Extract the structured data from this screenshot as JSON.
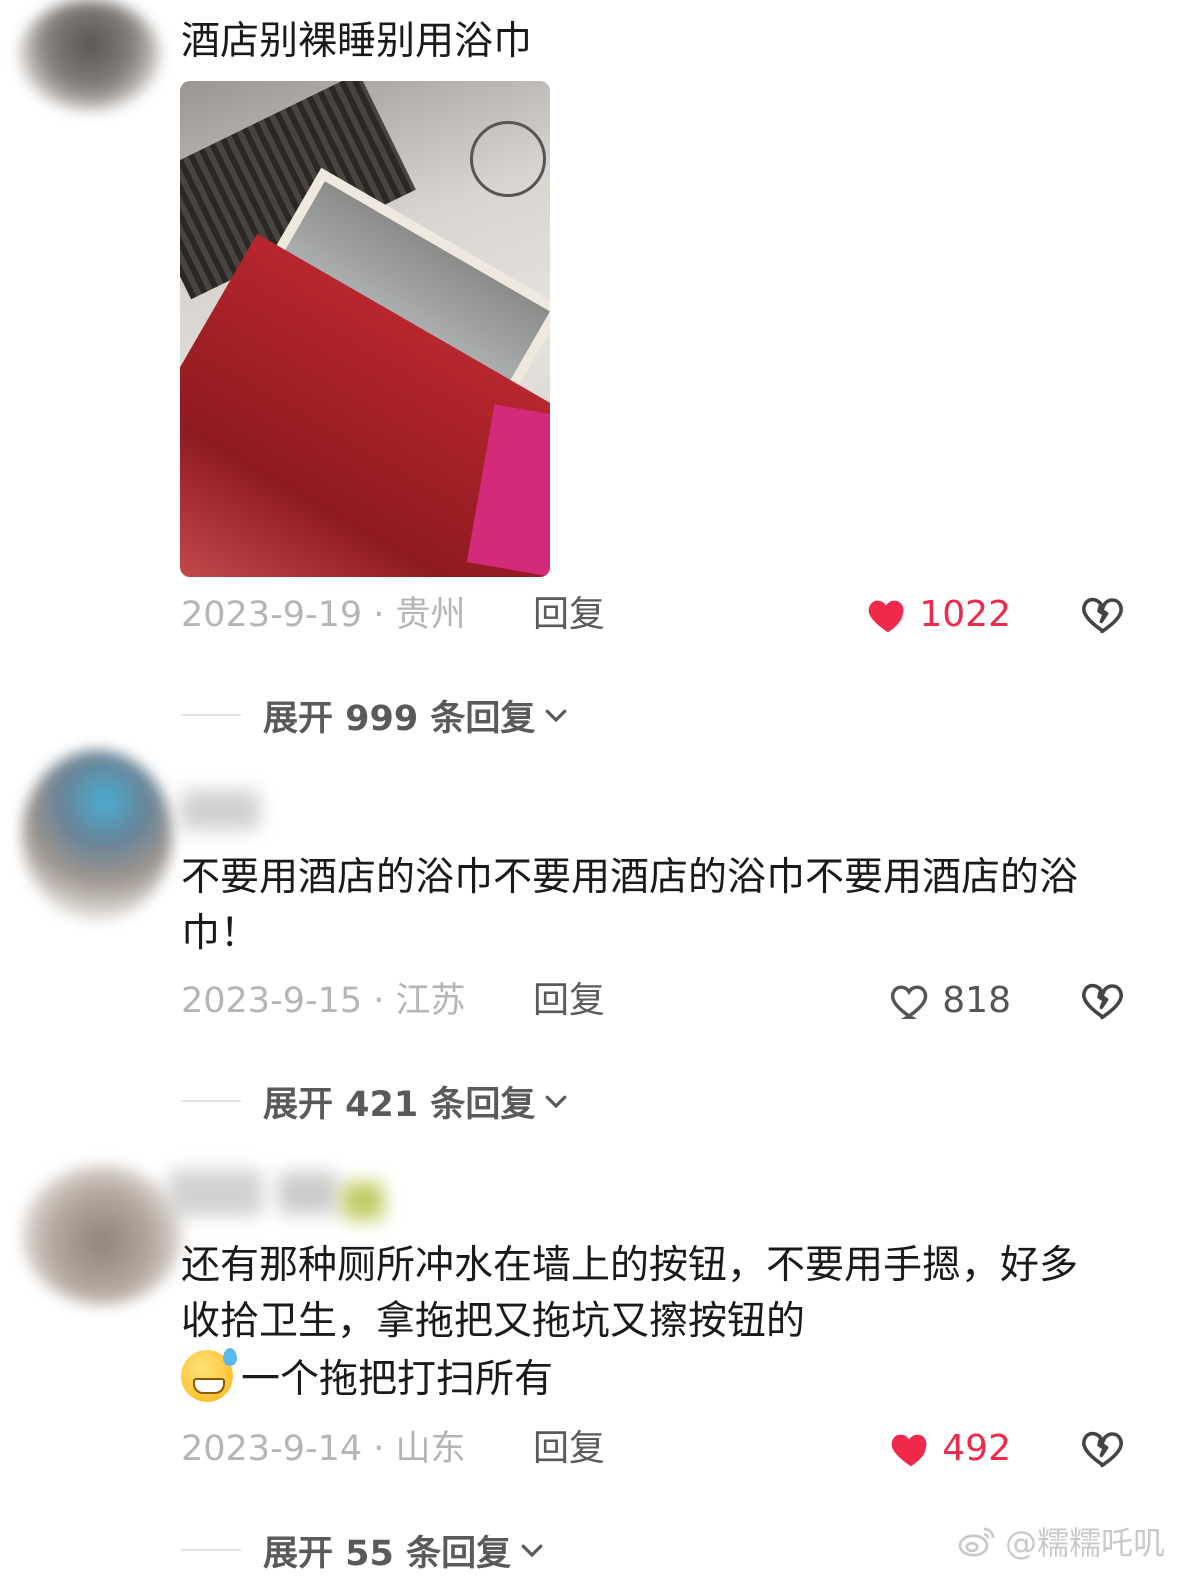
{
  "comments": [
    {
      "text": "酒店别裸睡别用浴巾",
      "date_location": "2023-9-19 · 贵州",
      "reply_label": "回复",
      "likes": "1022",
      "liked": true,
      "expand_label": "展开 999 条回复"
    },
    {
      "text": "不要用酒店的浴巾不要用酒店的浴巾不要用酒店的浴巾！",
      "date_location": "2023-9-15 · 江苏",
      "reply_label": "回复",
      "likes": "818",
      "liked": false,
      "expand_label": "展开 421 条回复"
    },
    {
      "text_line_1": "还有那种厕所冲水在墙上的按钮，不要用手摁，好多收拾卫生，拿拖把又拖坑又擦按钮的",
      "text_line_2": "一个拖把打扫所有",
      "emoji": "grinning-sweat-emoji",
      "date_location": "2023-9-14 · 山东",
      "reply_label": "回复",
      "likes": "492",
      "liked": true,
      "expand_label": "展开 55 条回复"
    }
  ],
  "watermark": "@糯糯吒叽",
  "colors": {
    "like_active": "#f0284a",
    "meta_gray": "#b5b5b5",
    "reply_gray": "#5a5a5a"
  }
}
